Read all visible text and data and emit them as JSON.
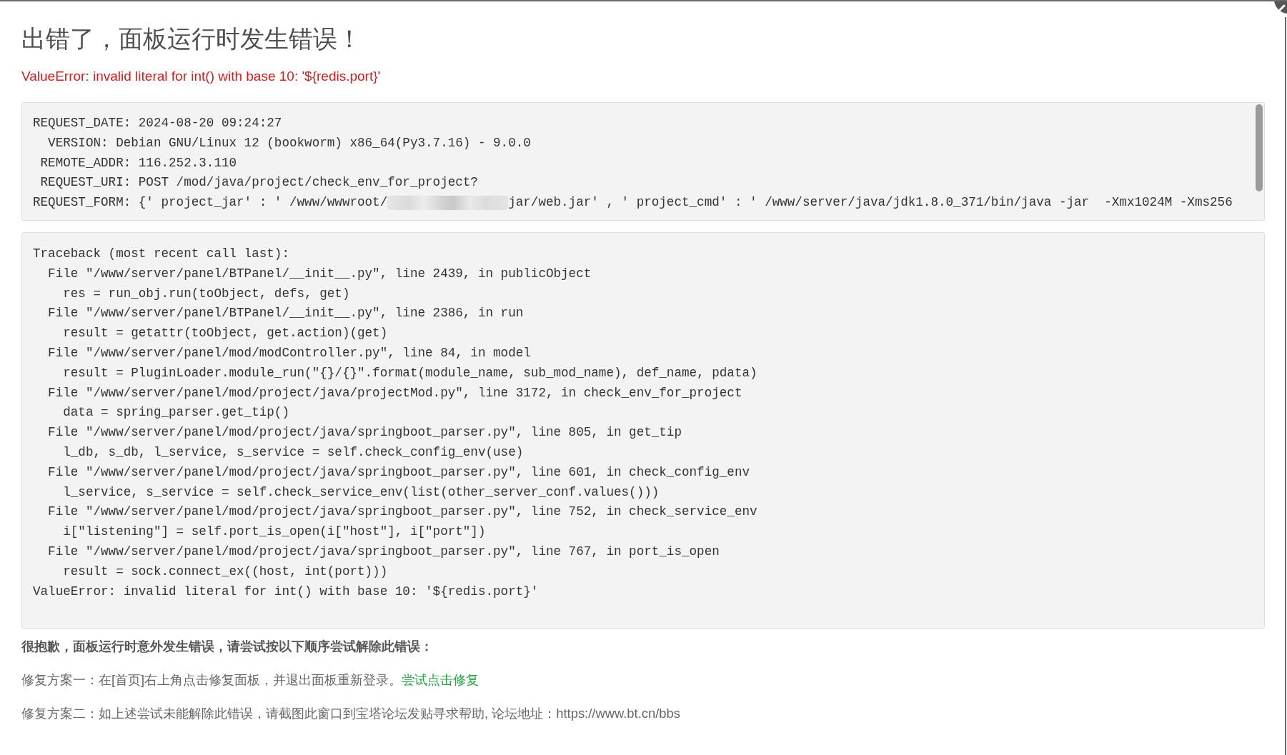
{
  "dialog": {
    "title": "出错了，面板运行时发生错误！",
    "error_message": "ValueError: invalid literal for int() with base 10: '${redis.port}'"
  },
  "request_info": {
    "lines": [
      {
        "kind": "plain",
        "text": "REQUEST_DATE: 2024-08-20 09:24:27"
      },
      {
        "kind": "plain",
        "text": "  VERSION: Debian GNU/Linux 12 (bookworm) x86_64(Py3.7.16) - 9.0.0"
      },
      {
        "kind": "plain",
        "text": " REMOTE_ADDR: 116.252.3.110"
      },
      {
        "kind": "plain",
        "text": " REQUEST_URI: POST /mod/java/project/check_env_for_project?"
      },
      {
        "kind": "redacted",
        "text": "REQUEST_FORM: {' project_jar' : ' /www/wwwroot/",
        "after": "jar/web.jar' , ' project_cmd' : ' /www/server/java/jdk1.8.0_371/bin/java -jar  -Xmx1024M -Xms256"
      }
    ]
  },
  "traceback": {
    "lines": [
      "Traceback (most recent call last):",
      "  File \"/www/server/panel/BTPanel/__init__.py\", line 2439, in publicObject",
      "    res = run_obj.run(toObject, defs, get)",
      "  File \"/www/server/panel/BTPanel/__init__.py\", line 2386, in run",
      "    result = getattr(toObject, get.action)(get)",
      "  File \"/www/server/panel/mod/modController.py\", line 84, in model",
      "    result = PluginLoader.module_run(\"{}/{}\".format(module_name, sub_mod_name), def_name, pdata)",
      "  File \"/www/server/panel/mod/project/java/projectMod.py\", line 3172, in check_env_for_project",
      "    data = spring_parser.get_tip()",
      "  File \"/www/server/panel/mod/project/java/springboot_parser.py\", line 805, in get_tip",
      "    l_db, s_db, l_service, s_service = self.check_config_env(use)",
      "  File \"/www/server/panel/mod/project/java/springboot_parser.py\", line 601, in check_config_env",
      "    l_service, s_service = self.check_service_env(list(other_server_conf.values()))",
      "  File \"/www/server/panel/mod/project/java/springboot_parser.py\", line 752, in check_service_env",
      "    i[\"listening\"] = self.port_is_open(i[\"host\"], i[\"port\"])",
      "  File \"/www/server/panel/mod/project/java/springboot_parser.py\", line 767, in port_is_open",
      "    result = sock.connect_ex((host, int(port)))",
      "ValueError: invalid literal for int() with base 10: '${redis.port}'"
    ]
  },
  "help": {
    "heading": "很抱歉，面板运行时意外发生错误，请尝试按以下顺序尝试解除此错误：",
    "steps": [
      {
        "text": "修复方案一：在[首页]右上角点击修复面板，并退出面板重新登录。",
        "link": "尝试点击修复"
      },
      {
        "text": "修复方案二：如上述尝试未能解除此错误，请截图此窗口到宝塔论坛发贴寻求帮助, 论坛地址：https://www.bt.cn/bbs"
      }
    ]
  }
}
